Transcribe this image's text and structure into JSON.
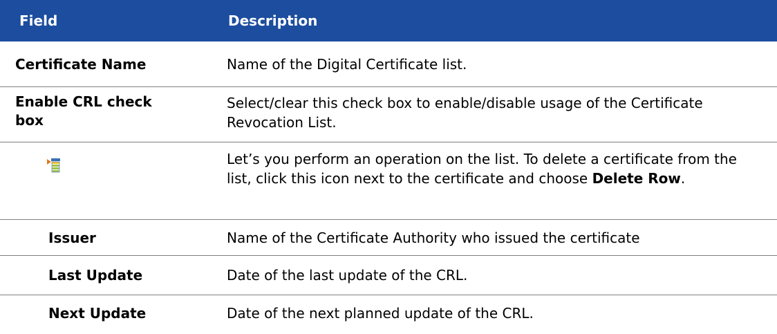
{
  "header": {
    "field": "Field",
    "description": "Description"
  },
  "rows": [
    {
      "field": "Certificate Name",
      "description": "Name of the Digital Certificate list."
    },
    {
      "field_line1": "Enable CRL check",
      "field_line2": "box",
      "description": "Select/clear this check box to enable/disable usage of the Certificate Revocation List."
    },
    {
      "icon": "row-menu-icon",
      "description_prefix": "Let’s you perform an operation on the list. To delete a certificate from the list, click this icon next to the certificate and choose ",
      "description_bold": "Delete Row",
      "description_suffix": "."
    },
    {
      "field": "Issuer",
      "description": "Name of the Certificate Authority who issued the certificate"
    },
    {
      "field": "Last Update",
      "description": "Date of the last update of the CRL."
    },
    {
      "field": "Next Update",
      "description": "Date of the next planned update of the CRL."
    }
  ],
  "colors": {
    "header_bg": "#1c4d9e",
    "header_text": "#ffffff",
    "row_border": "#7f7f7f"
  }
}
